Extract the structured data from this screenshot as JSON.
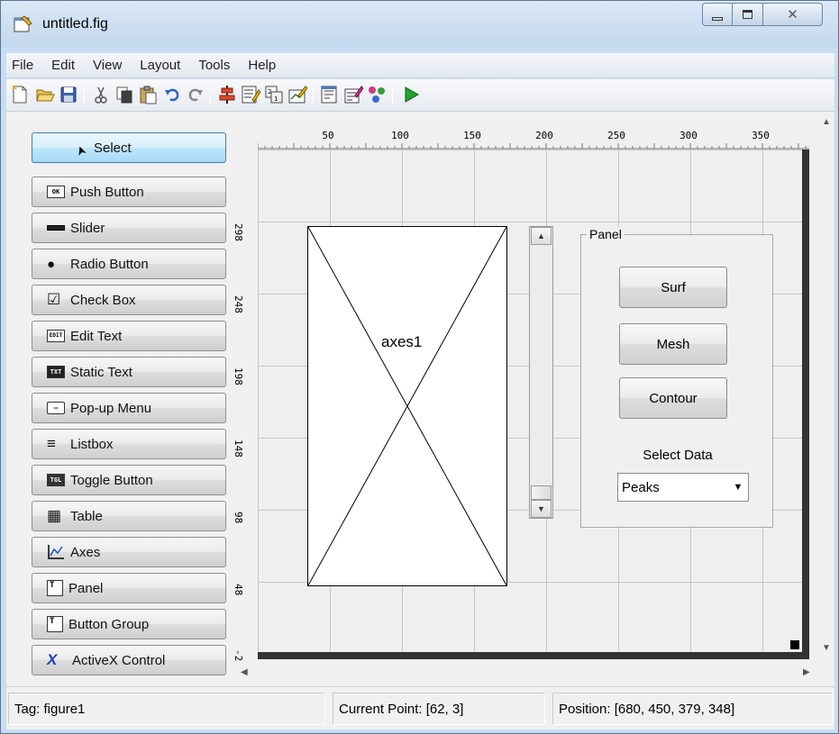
{
  "window": {
    "title": "untitled.fig",
    "close_glyph": "✕"
  },
  "menu": [
    "File",
    "Edit",
    "View",
    "Layout",
    "Tools",
    "Help"
  ],
  "toolbar": {
    "icons": [
      "new-file-icon",
      "open-folder-icon",
      "save-icon",
      "cut-icon",
      "copy-icon",
      "paste-icon",
      "undo-icon",
      "redo-icon",
      "align-objects-icon",
      "menu-editor-icon",
      "tab-order-icon",
      "toolbar-editor-icon",
      "editor-icon",
      "property-inspector-icon",
      "object-browser-icon",
      "run-figure-icon"
    ]
  },
  "palette": {
    "items": [
      {
        "label": "Select",
        "icon": "arrow-pointer-icon",
        "glyph": "➤"
      },
      {
        "label": "Push Button",
        "icon": "push-button-icon",
        "glyph": "OK"
      },
      {
        "label": "Slider",
        "icon": "slider-icon",
        "glyph": ""
      },
      {
        "label": "Radio Button",
        "icon": "radio-button-icon",
        "glyph": "●"
      },
      {
        "label": "Check Box",
        "icon": "check-box-icon",
        "glyph": "☑"
      },
      {
        "label": "Edit Text",
        "icon": "edit-text-icon",
        "glyph": "EDIT"
      },
      {
        "label": "Static Text",
        "icon": "static-text-icon",
        "glyph": "TXT"
      },
      {
        "label": "Pop-up Menu",
        "icon": "popup-menu-icon",
        "glyph": "▭"
      },
      {
        "label": "Listbox",
        "icon": "listbox-icon",
        "glyph": "≡"
      },
      {
        "label": "Toggle Button",
        "icon": "toggle-button-icon",
        "glyph": "TGL"
      },
      {
        "label": "Table",
        "icon": "table-icon",
        "glyph": "▦"
      },
      {
        "label": "Axes",
        "icon": "axes-icon",
        "glyph": "📈"
      },
      {
        "label": "Panel",
        "icon": "panel-icon",
        "glyph": "T"
      },
      {
        "label": "Button Group",
        "icon": "button-group-icon",
        "glyph": "T"
      },
      {
        "label": "ActiveX Control",
        "icon": "activex-icon",
        "glyph": "X"
      }
    ]
  },
  "rulers": {
    "top": [
      "50",
      "100",
      "150",
      "200",
      "250",
      "300",
      "350"
    ],
    "left": [
      "298",
      "248",
      "198",
      "148",
      "98",
      "48",
      "-2"
    ]
  },
  "figure": {
    "axes_label": "axes1",
    "panel_title": "Panel",
    "buttons": [
      "Surf",
      "Mesh",
      "Contour"
    ],
    "select_label": "Select Data",
    "popup_value": "Peaks"
  },
  "status": {
    "tag": "Tag: figure1",
    "current_point": "Current Point:  [62, 3]",
    "position": "Position: [680, 450, 379, 348]"
  },
  "colors": {
    "run_green": "#1fa32b",
    "selected_tool": "#bee6fd",
    "canvas_border": "#333333"
  }
}
